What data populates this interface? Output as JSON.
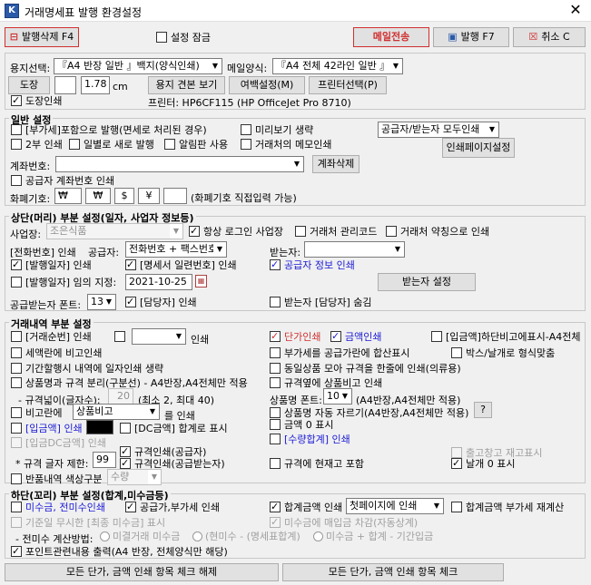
{
  "window": {
    "title": "거래명세표 발행 환경설정",
    "close": "✕"
  },
  "toolbar": {
    "delete_issue": "발행삭제 F4",
    "setting_lock": "설정 잠금",
    "mail_send": "메일전송",
    "issue": "발행 F7",
    "cancel": "취소 C"
  },
  "paper": {
    "label": "용지선택:",
    "value": "『A4 반장 일반 』백지(양식인쇄)",
    "mail_label": "메일양식:",
    "mail_value": "『A4 전체 42라인 일반 』",
    "stamp_btn": "도장",
    "stamp_size": "1.78",
    "unit": "cm",
    "preview_btn": "용지 견본 보기",
    "margin_btn": "여백설정(M)",
    "printer_btn": "프린터선택(P)",
    "stamp_print": "도장인쇄",
    "printer_text": "프린터: HP6CF115 (HP OfficeJet Pro 8710)"
  },
  "general": {
    "title": "일반 설정",
    "o1": "[부가세]포함으로 발행(면세로 처리된 경우)",
    "o2": "미리보기 생략",
    "target_select": "공급자/받는자 모두인쇄",
    "o3": "2부 인쇄",
    "o4": "일별로 새로 발행",
    "o5": "알림판 사용",
    "o6": "거래처의 메모인쇄",
    "print_page_btn": "인쇄페이지설정",
    "account_label": "계좌번호:",
    "account_delete_btn": "계좌삭제",
    "o7": "공급자 계좌번호 인쇄",
    "currency_label": "화폐기호:",
    "cur1": "₩",
    "cur2": "₩",
    "cur3": "$",
    "cur4": "¥",
    "currency_note": "(화폐기호 직접입력 가능)"
  },
  "top": {
    "title": "상단(머리) 부분 설정(일자, 사업자 정보등)",
    "biz_label": "사업장:",
    "biz_value": "조은식품",
    "o1": "항상 로그인 사업장",
    "o2": "거래처 관리코드",
    "o3": "거래처 약칭으로 인쇄",
    "phone_print": "[전화번호] 인쇄",
    "supplier_label": "공급자:",
    "supplier_value": "전화번호 + 팩스번호",
    "receiver_label": "받는자:",
    "o4": "[발행일자] 인쇄",
    "o5": "[명세서 일련번호] 인쇄",
    "o6": "공급자 정보 인쇄",
    "o7": "[발행일자] 임의 지정:",
    "date_value": "2021-10-25",
    "receiver_setting_btn": "받는자 설정",
    "font_label": "공급받는자 폰트:",
    "font_value": "13",
    "o8": "[담당자] 인쇄",
    "o9": "받는자 [담당자] 숨김"
  },
  "detail": {
    "title": "거래내역 부분 설정",
    "o1": "[거래순번] 인쇄",
    "o1b": "인쇄",
    "o2": "단가인쇄",
    "o3": "금액인쇄",
    "o4": "[입금액]하단비고에표시-A4전체",
    "o5": "세액란에 비고인쇄",
    "o6": "부가세를 공급가란에 합산표시",
    "o7": "박스/날개로 형식맞춤",
    "o8": "기간할행시 내역에 일자인쇄 생략",
    "o9": "동일상품 모아 규격을 한줄에 인쇄(의류용)",
    "o10": "상품명과 규격 분리(구분선) - A4반장,A4전체만 적용",
    "o11": "규격옆에 상품비고 인쇄",
    "width_label": "- 규격넓이(글자수):",
    "width_value": "20",
    "width_note": "(최소 2, 최대 40)",
    "name_font_label": "상품명 폰트:",
    "name_font_value": "10",
    "name_font_note": "(A4반장,A4전체만 적용)",
    "o12": "비고란에",
    "memo_select": "상품비고",
    "o12b": "를 인쇄",
    "o13": "상품명 자동 자르기(A4반장,A4전체만 적용)",
    "help": "?",
    "o14": "[입금액] 인쇄",
    "o15": "[DC금액] 합계로 표시",
    "o16": "금액 0 표시",
    "o17": "[입금DC금액] 인쇄",
    "o18": "[수량합계] 인쇄",
    "o19": "출고창고 재고표시",
    "limit_label": "* 규격 글자 제한:",
    "limit_value": "99",
    "o20": "규격인쇄(공급자)",
    "o21": "규격인쇄(공급받는자)",
    "o22": "규격에 현재고 포함",
    "o23": "날개 0 표시",
    "o24": "반품내역 색상구분",
    "return_select": "수량"
  },
  "bottom": {
    "title": "하단(꼬리) 부분 설정(합계,미수금등)",
    "o1": "미수금, 전미수인쇄",
    "o2": "공급가,부가세 인쇄",
    "o3": "합계금액 인쇄",
    "page_select": "첫페이지에 인쇄",
    "o4": "합계금액 부가세 재계산",
    "o5": "기준일 무시한 [최종 미수금] 표시",
    "o6": "미수금에 매입금 차감(자동상계)",
    "calc_label": "- 전미수 계산방법:",
    "r1": "미결거래 미수금",
    "r2": "(현미수 - (명세표합계)",
    "r3": "미수금 + 합계 - 기간입금",
    "o7": "포인트관련내용 출력(A4 반장, 전체양식만 해당)",
    "uncheck_all_btn": "모든 단가, 금액 인쇄 항목 체크 해제",
    "check_all_btn": "모든 단가, 금액 인쇄 항목 체크"
  },
  "colors": {
    "accent_red": "#d03030",
    "link_blue": "#1a1ad6"
  }
}
